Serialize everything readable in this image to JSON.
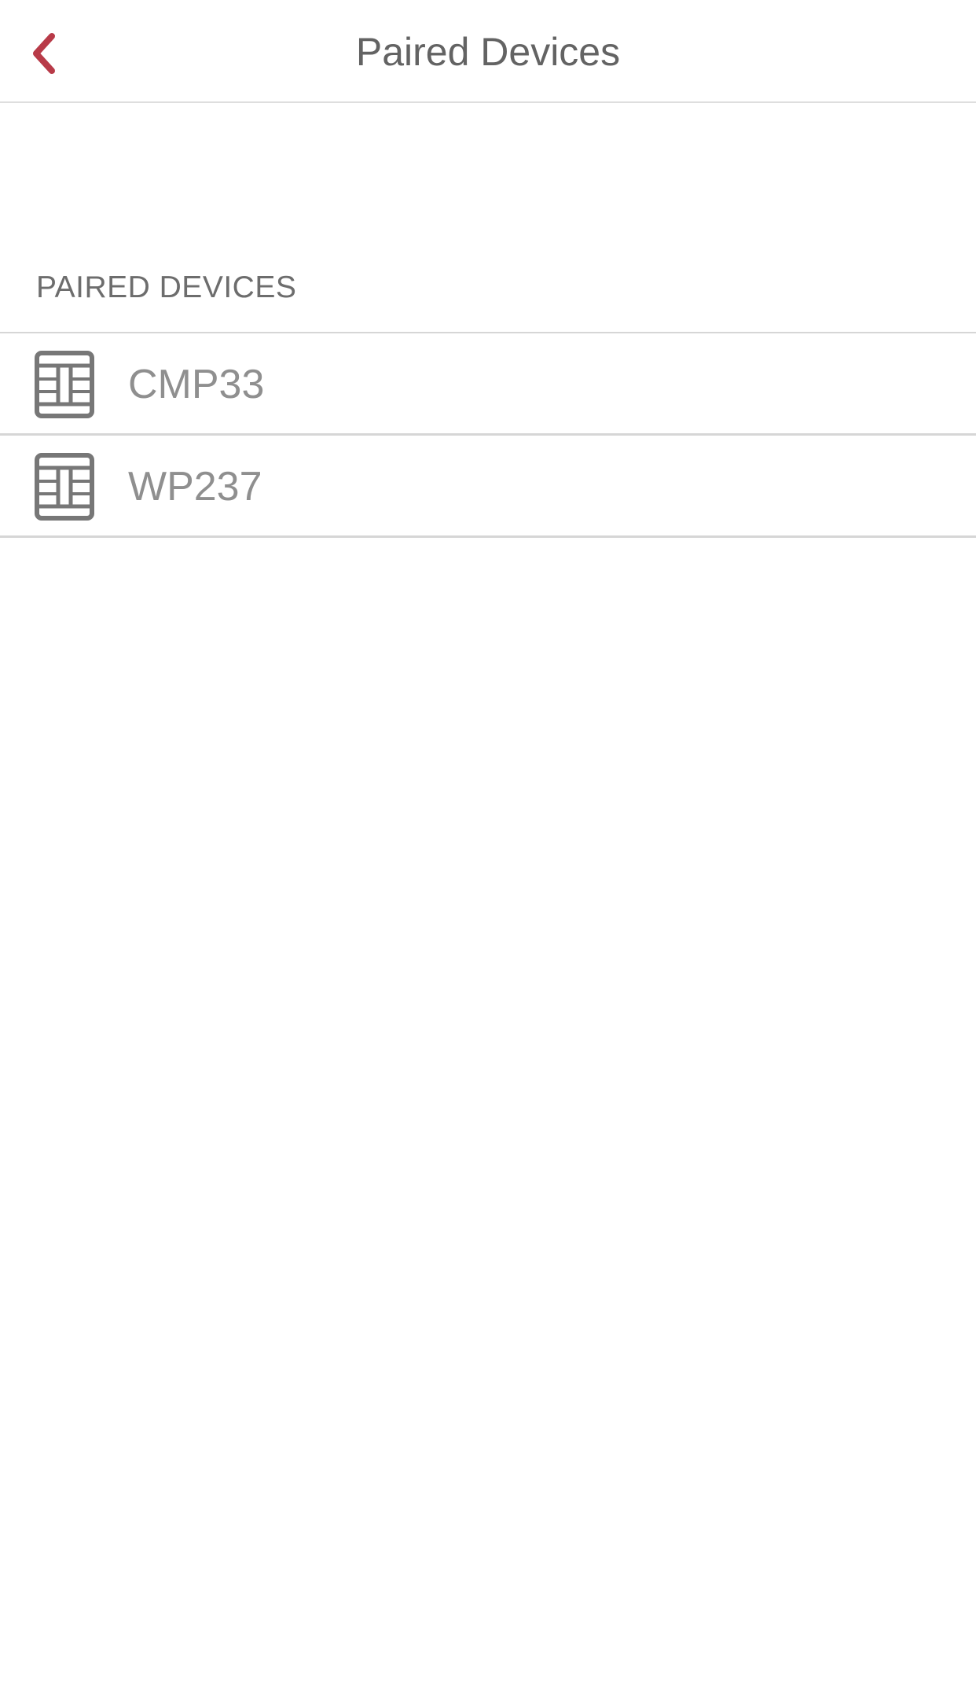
{
  "colors": {
    "accent": "#b83a48",
    "title_text": "#636363",
    "item_text": "#8f8f8f",
    "icon": "#777777",
    "divider": "#d6d6d6"
  },
  "header": {
    "title": "Paired Devices",
    "back_icon": "chevron-left-icon"
  },
  "section": {
    "title": "PAIRED DEVICES"
  },
  "devices": [
    {
      "label": "CMP33",
      "icon": "terminal-keypad-icon"
    },
    {
      "label": "WP237",
      "icon": "terminal-keypad-icon"
    }
  ]
}
